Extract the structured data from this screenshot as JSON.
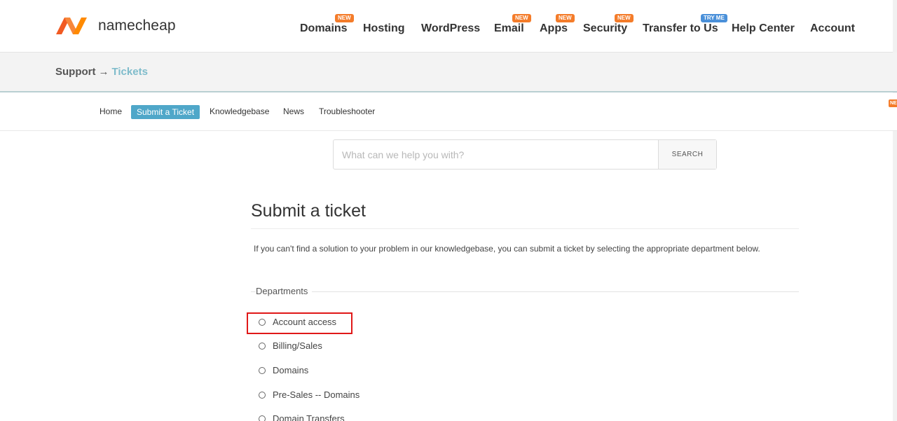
{
  "brand": {
    "name": "namecheap",
    "logo_colors": [
      "#f15a22",
      "#ff8a00"
    ]
  },
  "main_nav": [
    {
      "label": "Domains",
      "badge": "NEW"
    },
    {
      "label": "Hosting",
      "badge": ""
    },
    {
      "label": "WordPress",
      "badge": ""
    },
    {
      "label": "Email",
      "badge": "NEW"
    },
    {
      "label": "Apps",
      "badge": "NEW"
    },
    {
      "label": "Security",
      "badge": "NEW"
    },
    {
      "label": "Transfer to Us",
      "badge": "TRY ME"
    },
    {
      "label": "Help Center",
      "badge": ""
    },
    {
      "label": "Account",
      "badge": ""
    }
  ],
  "breadcrumb": {
    "root": "Support",
    "separator": "→",
    "current": "Tickets"
  },
  "sub_nav": [
    {
      "label": "Home",
      "active": false
    },
    {
      "label": "Submit a Ticket",
      "active": true
    },
    {
      "label": "Knowledgebase",
      "active": false
    },
    {
      "label": "News",
      "active": false
    },
    {
      "label": "Troubleshooter",
      "active": false
    }
  ],
  "edge_badge": "NE",
  "search": {
    "placeholder": "What can we help you with?",
    "value": "",
    "button_label": "SEARCH"
  },
  "content": {
    "title": "Submit a ticket",
    "intro": "If you can't find a solution to your problem in our knowledgebase, you can submit a ticket by selecting the appropriate department below.",
    "departments_label": "Departments",
    "departments": [
      "Account access",
      "Billing/Sales",
      "Domains",
      "Pre-Sales -- Domains",
      "Domain Transfers"
    ]
  },
  "colors": {
    "accent": "#4fa7c9",
    "badge_orange": "#f47c2a",
    "badge_blue": "#4a90d9",
    "crumb_current": "#7fbccb",
    "highlight": "#e01818"
  }
}
